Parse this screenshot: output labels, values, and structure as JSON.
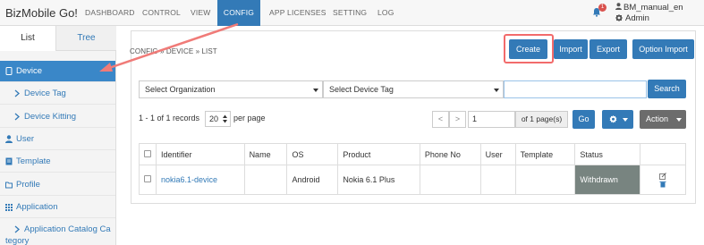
{
  "navbar": {
    "brand": "BizMobile Go!",
    "items": [
      {
        "label": "DASHBOARD"
      },
      {
        "label": "CONTROL"
      },
      {
        "label": "VIEW"
      },
      {
        "label": "CONFIG",
        "active": true
      },
      {
        "label": "APP LICENSES"
      },
      {
        "label": "SETTING"
      },
      {
        "label": "LOG"
      }
    ],
    "notification_count": "1",
    "user_name": "BM_manual_en",
    "user_role": "Admin"
  },
  "sidebar": {
    "tabs": [
      {
        "label": "List"
      },
      {
        "label": "Tree"
      }
    ],
    "items": [
      {
        "label": "Device",
        "icon": "tablet-icon",
        "active": true
      },
      {
        "label": "Device Tag",
        "icon": "chevron-right-icon"
      },
      {
        "label": "Device Kitting",
        "icon": "chevron-right-icon"
      },
      {
        "label": "User",
        "icon": "user-icon"
      },
      {
        "label": "Template",
        "icon": "template-icon"
      },
      {
        "label": "Profile",
        "icon": "folder-icon"
      },
      {
        "label": "Application",
        "icon": "grid-icon"
      },
      {
        "label": "Application Catalog Ca",
        "label2": "tegory",
        "icon": "chevron-right-icon"
      }
    ]
  },
  "main": {
    "breadcrumb": "CONFIG » DEVICE » LIST",
    "buttons": {
      "create": "Create",
      "import": "Import",
      "export": "Export",
      "option_import": "Option Import"
    },
    "filters": {
      "organization": "Select Organization",
      "device_tag": "Select Device Tag",
      "search_value": "",
      "search": "Search"
    },
    "pagination": {
      "records": "1 - 1 of 1 records",
      "per_page_value": "20",
      "per_page_label": "per page",
      "prev": "<",
      "next": ">",
      "page": "1",
      "of_pages": "of 1 page(s)",
      "go": "Go",
      "action": "Action"
    },
    "table": {
      "headers": [
        "Identifier",
        "Name",
        "OS",
        "Product",
        "Phone No",
        "User",
        "Template",
        "Status"
      ],
      "rows": [
        {
          "identifier": "nokia6.1-device",
          "name": "",
          "os": "Android",
          "product": "Nokia 6.1 Plus",
          "phone": "",
          "user": "",
          "template": "",
          "status": "Withdrawn"
        }
      ]
    }
  },
  "colors": {
    "primary": "#337ab7",
    "highlight": "#f26b6b",
    "withdrawn": "#788480"
  }
}
